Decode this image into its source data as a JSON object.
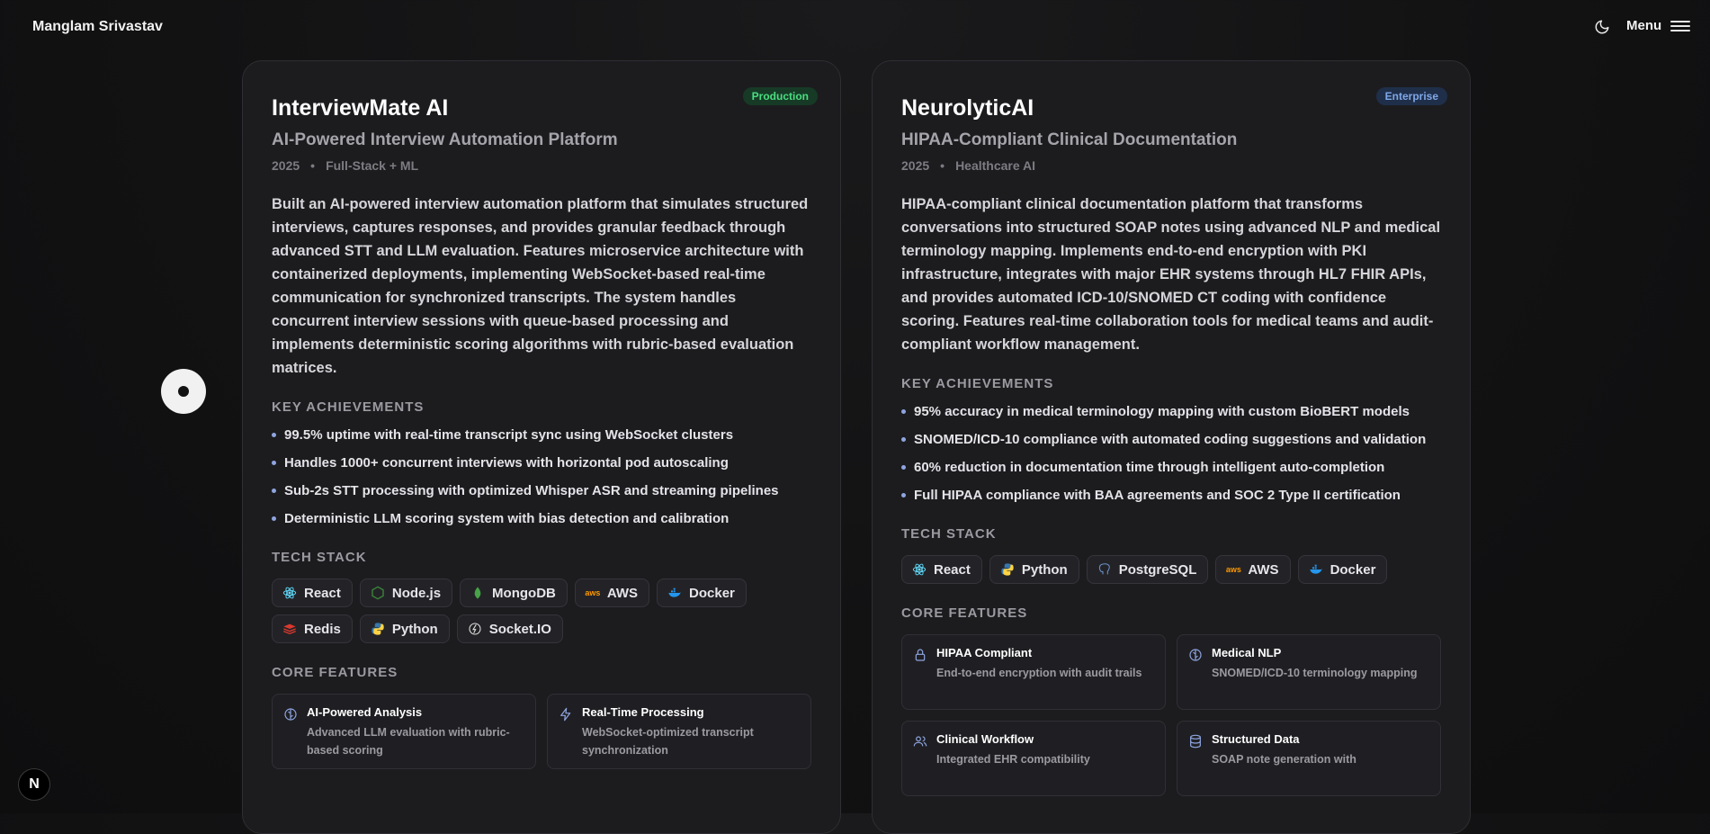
{
  "header": {
    "brand": "Manglam Srivastav",
    "theme_icon": "moon-icon",
    "menu_label": "Menu",
    "menu_icon": "hamburger-icon"
  },
  "projects": [
    {
      "badge": "Production",
      "title": "InterviewMate AI",
      "subtitle": "AI-Powered Interview Automation Platform",
      "year": "2025",
      "category": "Full-Stack + ML",
      "description": "Built an AI-powered interview automation platform that simulates structured interviews, captures responses, and provides granular feedback through advanced STT and LLM evaluation. Features microservice architecture with containerized deployments, implementing WebSocket-based real-time communication for synchronized transcripts. The system handles concurrent interview sessions with queue-based processing and implements deterministic scoring algorithms with rubric-based evaluation matrices.",
      "achievements_heading": "KEY ACHIEVEMENTS",
      "achievements": [
        "99.5% uptime with real-time transcript sync using WebSocket clusters",
        "Handles 1000+ concurrent interviews with horizontal pod autoscaling",
        "Sub-2s STT processing with optimized Whisper ASR and streaming pipelines",
        "Deterministic LLM scoring system with bias detection and calibration"
      ],
      "stack_heading": "TECH STACK",
      "stack": [
        {
          "label": "React",
          "icon": "react-icon"
        },
        {
          "label": "Node.js",
          "icon": "nodejs-icon"
        },
        {
          "label": "MongoDB",
          "icon": "mongodb-icon"
        },
        {
          "label": "AWS",
          "icon": "aws-icon"
        },
        {
          "label": "Docker",
          "icon": "docker-icon"
        },
        {
          "label": "Redis",
          "icon": "redis-icon"
        },
        {
          "label": "Python",
          "icon": "python-icon"
        },
        {
          "label": "Socket.IO",
          "icon": "socketio-icon"
        }
      ],
      "features_heading": "CORE FEATURES",
      "features": [
        {
          "title": "AI-Powered Analysis",
          "desc": "Advanced LLM evaluation with rubric-based scoring",
          "icon": "brain-icon"
        },
        {
          "title": "Real-Time Processing",
          "desc": "WebSocket-optimized transcript synchronization",
          "icon": "lightning-icon"
        }
      ]
    },
    {
      "badge": "Enterprise",
      "title": "NeurolyticAI",
      "subtitle": "HIPAA-Compliant Clinical Documentation",
      "year": "2025",
      "category": "Healthcare AI",
      "description": "HIPAA-compliant clinical documentation platform that transforms conversations into structured SOAP notes using advanced NLP and medical terminology mapping. Implements end-to-end encryption with PKI infrastructure, integrates with major EHR systems through HL7 FHIR APIs, and provides automated ICD-10/SNOMED CT coding with confidence scoring. Features real-time collaboration tools for medical teams and audit-compliant workflow management.",
      "achievements_heading": "KEY ACHIEVEMENTS",
      "achievements": [
        "95% accuracy in medical terminology mapping with custom BioBERT models",
        "SNOMED/ICD-10 compliance with automated coding suggestions and validation",
        "60% reduction in documentation time through intelligent auto-completion",
        "Full HIPAA compliance with BAA agreements and SOC 2 Type II certification"
      ],
      "stack_heading": "TECH STACK",
      "stack": [
        {
          "label": "React",
          "icon": "react-icon"
        },
        {
          "label": "Python",
          "icon": "python-icon"
        },
        {
          "label": "PostgreSQL",
          "icon": "postgresql-icon"
        },
        {
          "label": "AWS",
          "icon": "aws-icon"
        },
        {
          "label": "Docker",
          "icon": "docker-icon"
        }
      ],
      "features_heading": "CORE FEATURES",
      "features": [
        {
          "title": "HIPAA Compliant",
          "desc": "End-to-end encryption with audit trails",
          "icon": "lock-icon"
        },
        {
          "title": "Medical NLP",
          "desc": "SNOMED/ICD-10 terminology mapping",
          "icon": "brain-icon"
        },
        {
          "title": "Clinical Workflow",
          "desc": "Integrated EHR compatibility",
          "icon": "users-icon"
        },
        {
          "title": "Structured Data",
          "desc": "SOAP note generation with",
          "icon": "database-icon"
        }
      ]
    }
  ],
  "floating": {
    "cursor_icon": "cursor-dot-icon",
    "framework_badge": "N"
  },
  "colors": {
    "accent": "#8fa5e0",
    "production": "#4ade80",
    "enterprise": "#7fa8e8",
    "background": "#121213"
  }
}
